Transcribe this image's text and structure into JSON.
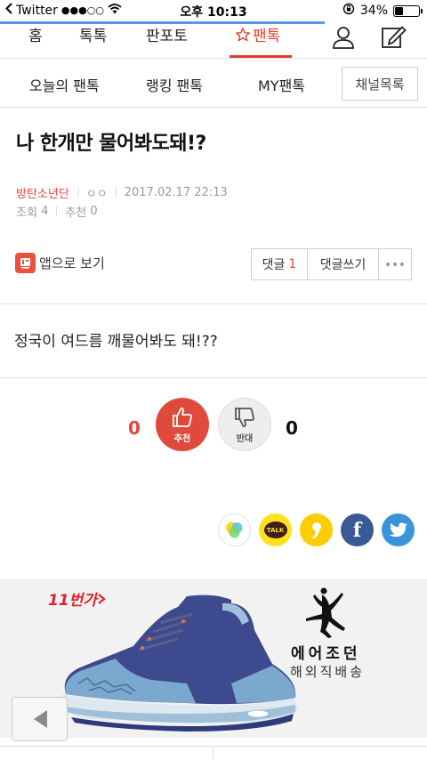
{
  "status_bar": {
    "back_app": "Twitter",
    "signal": "●●●○○",
    "time": "오후 10:13",
    "battery": "34%",
    "battery_level": 0.34
  },
  "top_nav": {
    "tabs": [
      "홈",
      "톡톡",
      "판포토",
      "팬톡"
    ],
    "active_tab": "팬톡",
    "accent_color": "#e83a2b"
  },
  "sub_nav": {
    "items": [
      "오늘의 팬톡",
      "랭킹 팬톡",
      "MY팬톡"
    ],
    "channel_button": "채널목록"
  },
  "post": {
    "title": "나 한개만 물어봐도돼!?",
    "author": "방탄소년단",
    "nickname": "ㅇㅇ",
    "datetime": "2017.02.17 22:13",
    "views_label": "조회",
    "views": "4",
    "recommend_label": "추천",
    "recommend": "0",
    "app_view": "앱으로 보기",
    "comments_label": "댓글",
    "comments_count": "1",
    "write_comment": "댓글쓰기",
    "body": "정국이 여드름 깨물어봐도 돼!??"
  },
  "vote": {
    "up_count": "0",
    "up_label": "추천",
    "down_label": "반대",
    "down_count": "0"
  },
  "share": {
    "kakaotalk_label": "TALK",
    "facebook_label": "f"
  },
  "ad": {
    "logo": "11번가",
    "title": "에어조던",
    "subtitle": "해외직배송"
  }
}
